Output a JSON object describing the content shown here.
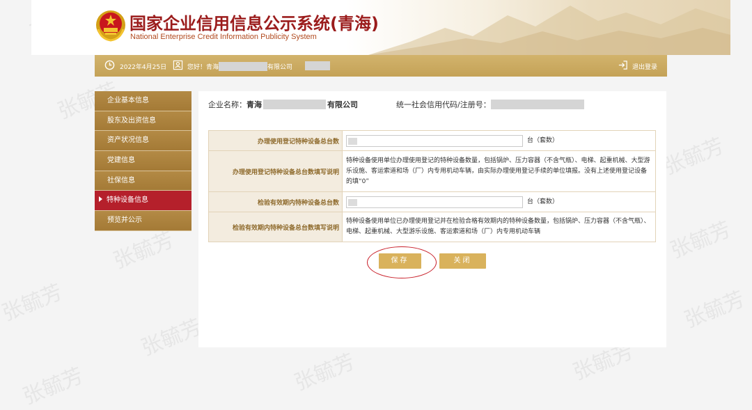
{
  "header": {
    "title": "国家企业信用信息公示系统",
    "region": "(青海)",
    "subtitle": "National Enterprise Credit Information Publicity System"
  },
  "topbar": {
    "date": "2022年4月25日",
    "greeting_prefix": "您好！青海",
    "greeting_suffix": "有限公司",
    "logout": "退出登录"
  },
  "sidebar": {
    "items": [
      {
        "label": "企业基本信息"
      },
      {
        "label": "股东及出资信息"
      },
      {
        "label": "资产状况信息"
      },
      {
        "label": "党建信息"
      },
      {
        "label": "社保信息"
      },
      {
        "label": "特种设备信息"
      },
      {
        "label": "预览并公示"
      }
    ]
  },
  "main": {
    "company_label": "企业名称：",
    "company_prefix": "青海",
    "company_suffix": "有限公司",
    "code_label": "统一社会信用代码/注册号："
  },
  "form": {
    "row1_label": "办理使用登记特种设备总台数",
    "row1_unit": "台（套数）",
    "row2_label": "办理使用登记特种设备总台数填写说明",
    "row2_text": "特种设备使用单位办理使用登记的特种设备数量，包括锅炉、压力容器（不含气瓶）、电梯、起重机械、大型游乐设施、客运索道和场（厂）内专用机动车辆，由实际办理使用登记手续的单位填报。没有上述使用登记设备的填“0”",
    "row3_label": "检验有效期内特种设备总台数",
    "row3_unit": "台（套数）",
    "row4_label": "检验有效期内特种设备总台数填写说明",
    "row4_text": "特种设备使用单位已办理使用登记并在检验合格有效期内的特种设备数量，包括锅炉、压力容器（不含气瓶）、电梯、起重机械、大型游乐设施、客运索道和场（厂）内专用机动车辆"
  },
  "buttons": {
    "save": "保存",
    "close": "关闭"
  },
  "watermark": "张毓芳",
  "colors": {
    "gold": "#c4a257",
    "sidebar": "#a47a36",
    "active": "#b5202b",
    "title_red": "#9b1c1c"
  }
}
